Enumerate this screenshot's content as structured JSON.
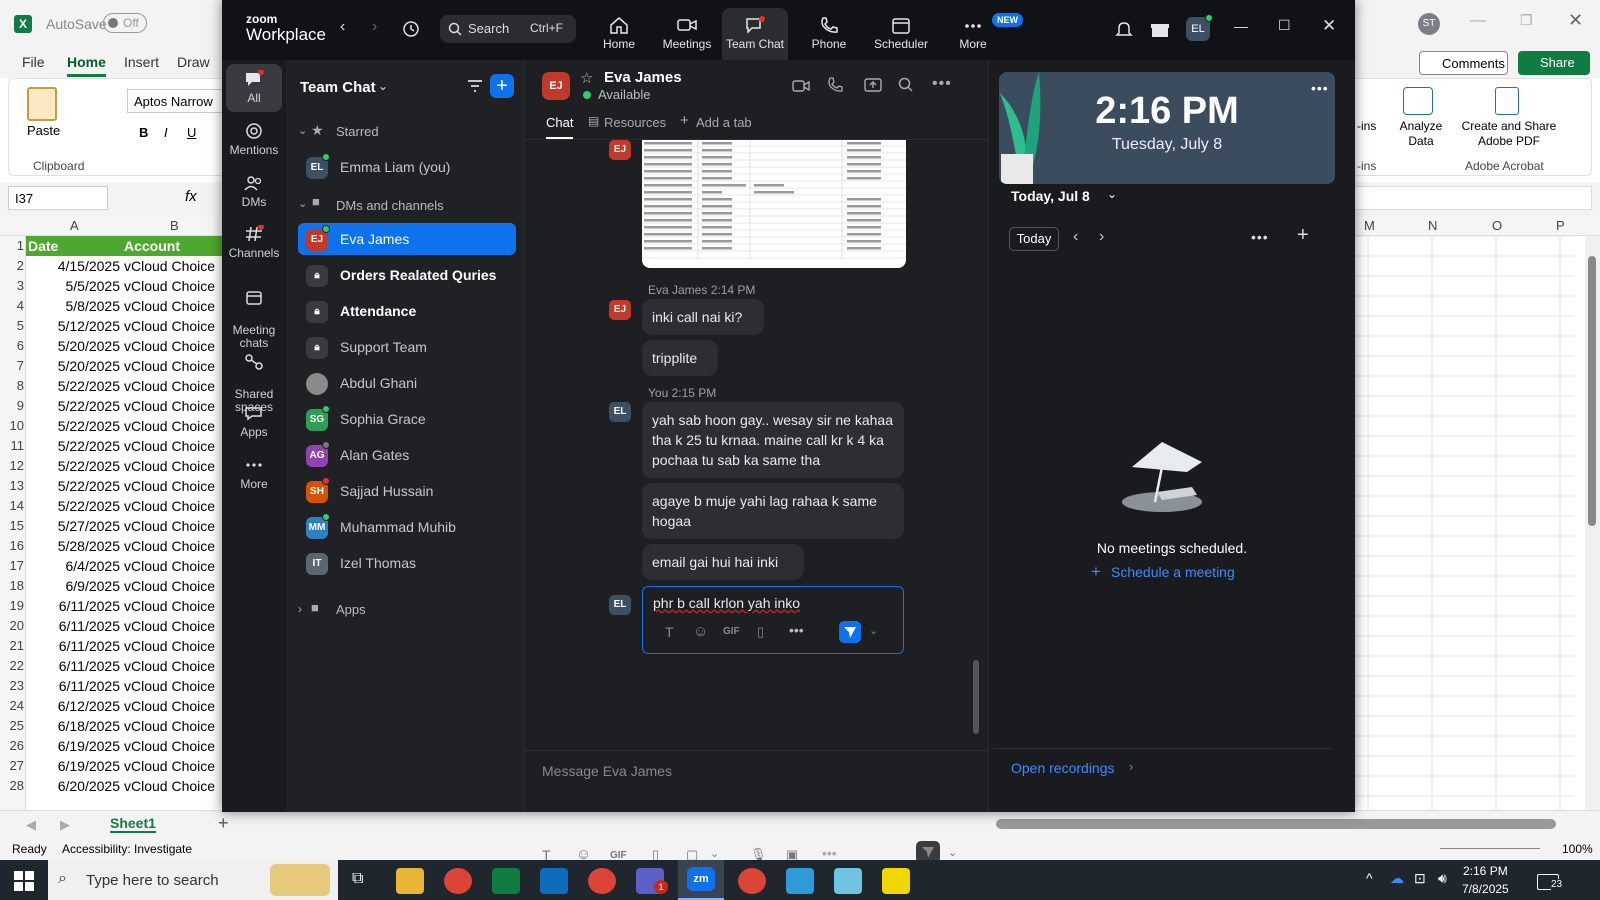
{
  "excel": {
    "autosave_label": "AutoSave",
    "autosave_state": "Off",
    "tabs": [
      "File",
      "Home",
      "Insert",
      "Draw"
    ],
    "active_tab": "Home",
    "font_name": "Aptos Narrow",
    "clipboard_group": "Clipboard",
    "paste_label": "Paste",
    "cell_ref": "I37",
    "fx": "fx",
    "user_initials": "ST",
    "comments_label": "Comments",
    "share_label": "Share",
    "analyze_data": "Analyze\nData",
    "create_share_pdf": "Create and Share\nAdobe PDF",
    "adobe_group": "Adobe Acrobat",
    "addins_fragment_1": "-ins",
    "addins_fragment_2": "-ins",
    "columns_left": [
      "A",
      "B"
    ],
    "columns_right": [
      "M",
      "N",
      "O",
      "P"
    ],
    "headers": {
      "date": "Date",
      "account": "Account"
    },
    "rows": [
      {
        "n": "2",
        "date": "4/15/2025",
        "account": "vCloud Choice"
      },
      {
        "n": "3",
        "date": "5/5/2025",
        "account": "vCloud Choice"
      },
      {
        "n": "4",
        "date": "5/8/2025",
        "account": "vCloud Choice"
      },
      {
        "n": "5",
        "date": "5/12/2025",
        "account": "vCloud Choice"
      },
      {
        "n": "6",
        "date": "5/20/2025",
        "account": "vCloud Choice"
      },
      {
        "n": "7",
        "date": "5/20/2025",
        "account": "vCloud Choice"
      },
      {
        "n": "8",
        "date": "5/22/2025",
        "account": "vCloud Choice"
      },
      {
        "n": "9",
        "date": "5/22/2025",
        "account": "vCloud Choice"
      },
      {
        "n": "10",
        "date": "5/22/2025",
        "account": "vCloud Choice"
      },
      {
        "n": "11",
        "date": "5/22/2025",
        "account": "vCloud Choice"
      },
      {
        "n": "12",
        "date": "5/22/2025",
        "account": "vCloud Choice"
      },
      {
        "n": "13",
        "date": "5/22/2025",
        "account": "vCloud Choice"
      },
      {
        "n": "14",
        "date": "5/22/2025",
        "account": "vCloud Choice"
      },
      {
        "n": "15",
        "date": "5/27/2025",
        "account": "vCloud Choice"
      },
      {
        "n": "16",
        "date": "5/28/2025",
        "account": "vCloud Choice"
      },
      {
        "n": "17",
        "date": "6/4/2025",
        "account": "vCloud Choice"
      },
      {
        "n": "18",
        "date": "6/9/2025",
        "account": "vCloud Choice"
      },
      {
        "n": "19",
        "date": "6/11/2025",
        "account": "vCloud Choice"
      },
      {
        "n": "20",
        "date": "6/11/2025",
        "account": "vCloud Choice"
      },
      {
        "n": "21",
        "date": "6/11/2025",
        "account": "vCloud Choice"
      },
      {
        "n": "22",
        "date": "6/11/2025",
        "account": "vCloud Choice"
      },
      {
        "n": "23",
        "date": "6/11/2025",
        "account": "vCloud Choice"
      },
      {
        "n": "24",
        "date": "6/12/2025",
        "account": "vCloud Choice"
      },
      {
        "n": "25",
        "date": "6/18/2025",
        "account": "vCloud Choice"
      },
      {
        "n": "26",
        "date": "6/19/2025",
        "account": "vCloud Choice"
      },
      {
        "n": "27",
        "date": "6/19/2025",
        "account": "vCloud Choice"
      },
      {
        "n": "28",
        "date": "6/20/2025",
        "account": "vCloud Choice"
      }
    ],
    "sheet_tab": "Sheet1",
    "status_ready": "Ready",
    "accessibility": "Accessibility: Investigate",
    "zoom_pct": "100%"
  },
  "zoom": {
    "brand_line1": "zoom",
    "brand_line2": "Workplace",
    "search_label": "Search",
    "search_shortcut": "Ctrl+F",
    "nav": [
      "Home",
      "Meetings",
      "Team Chat",
      "Phone",
      "Scheduler",
      "More"
    ],
    "new_badge": "NEW",
    "user_initials": "EL",
    "rail": [
      "All",
      "Mentions",
      "DMs",
      "Channels",
      "Meeting\nchats",
      "Shared\nspaces",
      "Apps",
      "More"
    ],
    "list_title": "Team Chat",
    "section_starred": "Starred",
    "section_dms": "DMs and channels",
    "section_apps": "Apps",
    "items": [
      {
        "label": "Emma Liam (you)",
        "initials": "EL",
        "color": "#3d4f63"
      },
      {
        "label": "Eva James",
        "initials": "EJ",
        "color": "#c0392b"
      },
      {
        "label": "Orders Realated Quries",
        "initials": "",
        "color": "#3a3b40"
      },
      {
        "label": "Attendance",
        "initials": "",
        "color": "#3a3b40"
      },
      {
        "label": "Support Team",
        "initials": "",
        "color": "#3a3b40"
      },
      {
        "label": "Abdul Ghani",
        "initials": "",
        "color": "#6b6b6b"
      },
      {
        "label": "Sophia Grace",
        "initials": "SG",
        "color": "#2e9e57"
      },
      {
        "label": "Alan Gates",
        "initials": "AG",
        "color": "#8e44ad"
      },
      {
        "label": "Sajjad Hussain",
        "initials": "SH",
        "color": "#d35400"
      },
      {
        "label": "Muhammad Muhib",
        "initials": "MM",
        "color": "#2f80c0"
      },
      {
        "label": "Izel Thomas",
        "initials": "IT",
        "color": "#5a6770"
      }
    ],
    "chat": {
      "name": "Eva James",
      "status": "Available",
      "avatar": "EJ",
      "tabs": [
        "Chat",
        "Resources",
        "Add a tab"
      ],
      "meta_eva": "Eva James 2:14 PM",
      "meta_you": "You 2:15 PM",
      "eva_msgs": [
        "inki call nai ki?",
        "tripplite"
      ],
      "you_msgs": [
        "yah sab hoon gay.. wesay sir ne kahaa tha k 25 tu krnaa. maine call kr k 4 ka pochaa tu sab ka same tha",
        "agaye b muje yahi lag rahaa k same hogaa",
        "email gai hui hai inki"
      ],
      "editing_text": "phr b call krlon yah inko",
      "composer_placeholder": "Message Eva James",
      "gif_label": "GIF"
    },
    "calendar": {
      "time": "2:16 PM",
      "date": "Tuesday, July 8",
      "today_header": "Today, Jul 8",
      "today_btn": "Today",
      "empty_text": "No meetings scheduled.",
      "schedule_link": "Schedule a meeting",
      "open_recordings": "Open recordings"
    }
  },
  "taskbar": {
    "search_placeholder": "Type here to search",
    "time": "2:16 PM",
    "date": "7/8/2025",
    "notif_count": "23",
    "teams_badge": "1"
  },
  "colors": {
    "zoom_blue": "#0e72ed",
    "selected_row": "#0e72ed",
    "excel_green": "#107c41",
    "header_fill": "#4ea72e"
  }
}
